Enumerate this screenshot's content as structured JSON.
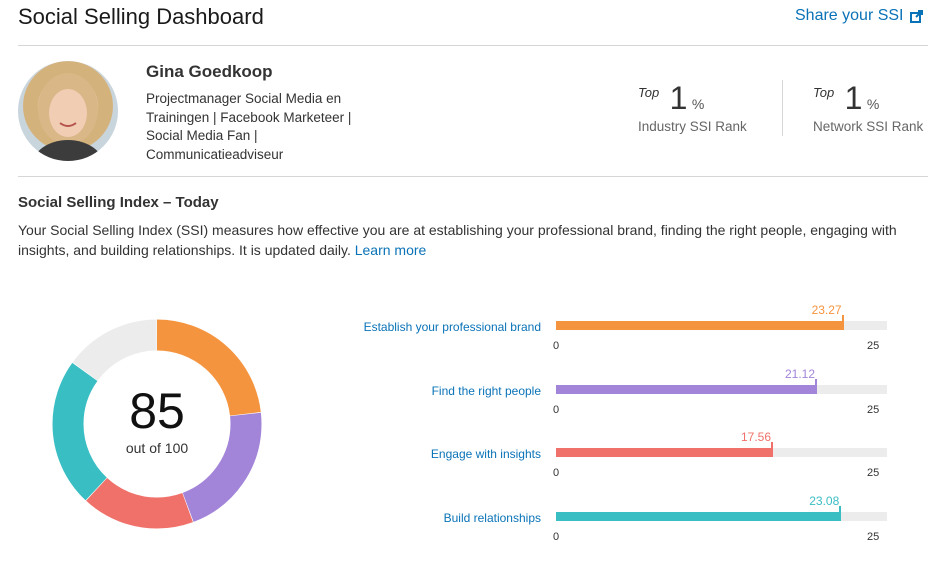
{
  "header": {
    "title": "Social Selling Dashboard",
    "share_label": "Share your SSI"
  },
  "profile": {
    "name": "Gina Goedkoop",
    "headline_lines": [
      "Projectmanager Social Media en",
      "Trainingen | Facebook Marketeer |",
      "Social Media Fan |",
      "Communicatieadviseur"
    ]
  },
  "ranks": [
    {
      "top_label": "Top",
      "value": "1",
      "unit": "%",
      "label": "Industry SSI Rank"
    },
    {
      "top_label": "Top",
      "value": "1",
      "unit": "%",
      "label": "Network SSI Rank"
    }
  ],
  "ssi": {
    "section_title": "Social Selling Index – Today",
    "description": "Your Social Selling Index (SSI) measures how effective you are at establishing your professional brand, finding the right people, engaging with insights, and building relationships. It is updated daily.",
    "learn_more": "Learn more",
    "score": "85",
    "out_of": "out of 100",
    "axis_min": "0",
    "axis_max": "25"
  },
  "chart_data": {
    "type": "bar",
    "categories": [
      "Establish your professional brand",
      "Find the right people",
      "Engage with insights",
      "Build relationships"
    ],
    "values": [
      23.27,
      21.12,
      17.56,
      23.08
    ],
    "value_labels": [
      "23.27",
      "21.12",
      "17.56",
      "23.08"
    ],
    "xlim": [
      0,
      25
    ],
    "colors": [
      "#f5943f",
      "#a284d9",
      "#f0716a",
      "#39bec4"
    ],
    "donut": {
      "total": 100,
      "remaining_color": "#ececec"
    }
  }
}
